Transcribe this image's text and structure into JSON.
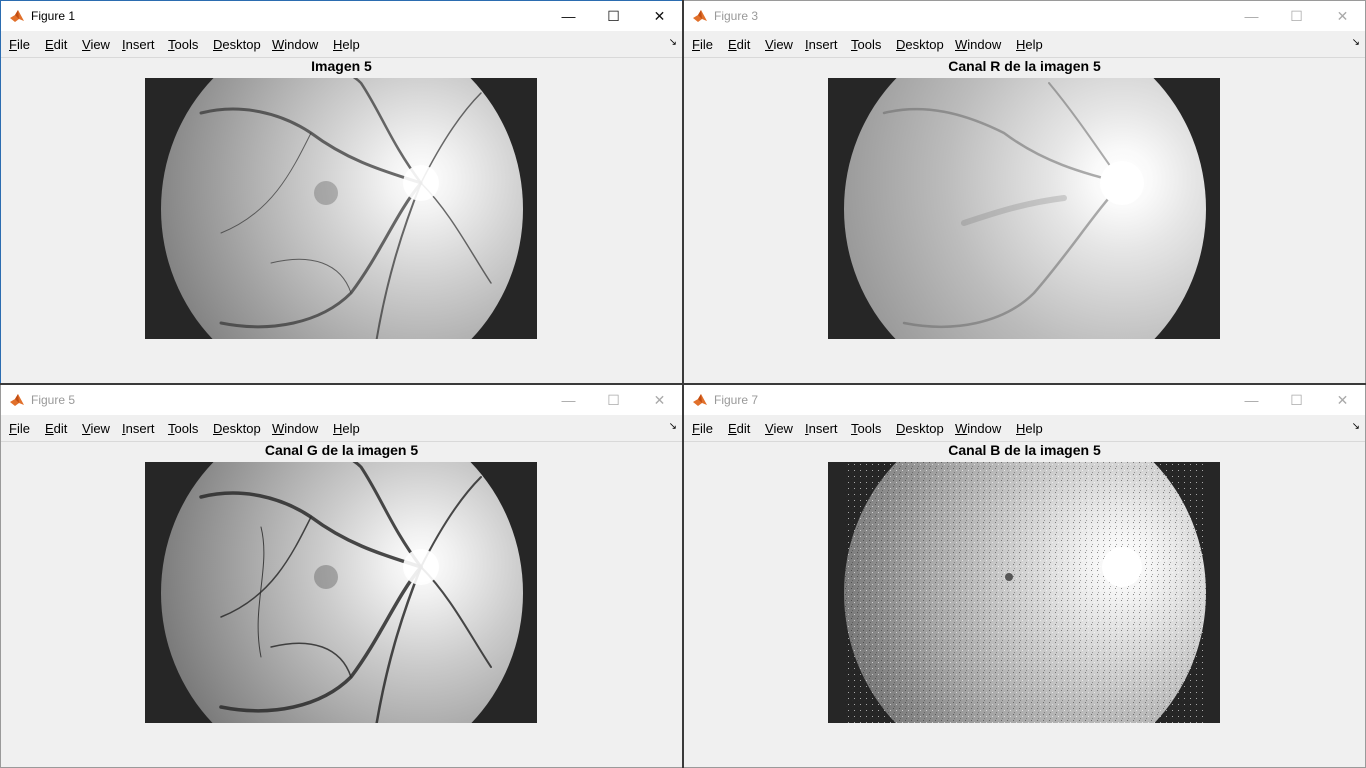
{
  "menu": {
    "items": [
      {
        "accel": "F",
        "rest": "ile"
      },
      {
        "accel": "E",
        "rest": "dit"
      },
      {
        "accel": "V",
        "rest": "iew"
      },
      {
        "accel": "I",
        "rest": "nsert"
      },
      {
        "accel": "T",
        "rest": "ools"
      },
      {
        "accel": "D",
        "rest": "esktop"
      },
      {
        "accel": "W",
        "rest": "indow"
      },
      {
        "accel": "H",
        "rest": "elp"
      }
    ]
  },
  "windows": [
    {
      "title": "Figure 1",
      "state": "active",
      "plot_title": "Imagen 5"
    },
    {
      "title": "Figure 3",
      "state": "inactive",
      "plot_title": "Canal R de la imagen 5"
    },
    {
      "title": "Figure 5",
      "state": "inactive",
      "plot_title": "Canal G de la imagen 5"
    },
    {
      "title": "Figure 7",
      "state": "inactive",
      "plot_title": "Canal B de la imagen 5"
    }
  ],
  "icons": {
    "app": "matlab-icon",
    "minimize": "minimize-icon",
    "maximize": "maximize-icon",
    "close": "close-icon",
    "dock": "dock-arrow-icon"
  },
  "colors": {
    "active_border": "#2b6cb0",
    "axes_background": "#262626",
    "figure_background": "#f0f0f0"
  }
}
